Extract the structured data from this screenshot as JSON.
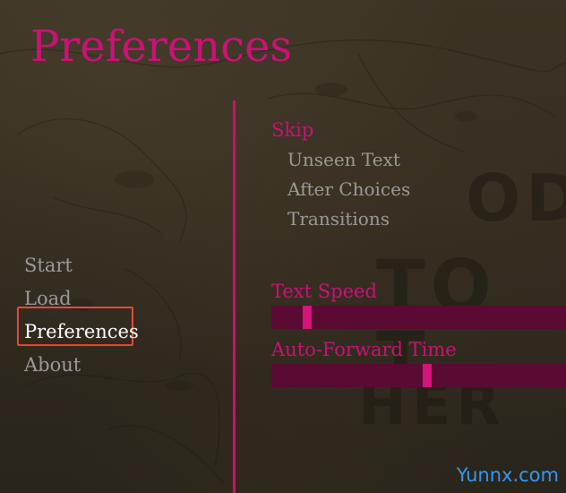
{
  "title": "Preferences",
  "nav": {
    "items": [
      {
        "label": "Start"
      },
      {
        "label": "Load"
      },
      {
        "label": "Preferences",
        "active": true
      },
      {
        "label": "About"
      }
    ]
  },
  "skip": {
    "label": "Skip",
    "options": [
      "Unseen Text",
      "After Choices",
      "Transitions"
    ]
  },
  "text_speed": {
    "label": "Text Speed",
    "value": 0.11
  },
  "auto_forward": {
    "label": "Auto-Forward Time",
    "value": 0.53
  },
  "watermark": "Yunnx.com",
  "colors": {
    "accent": "#cc1177",
    "slider_track": "#5a0a33",
    "slider_thumb": "#d4157a",
    "inactive_text": "#9a9a9a",
    "active_text": "#ffffff",
    "highlight": "#e04a3a"
  }
}
